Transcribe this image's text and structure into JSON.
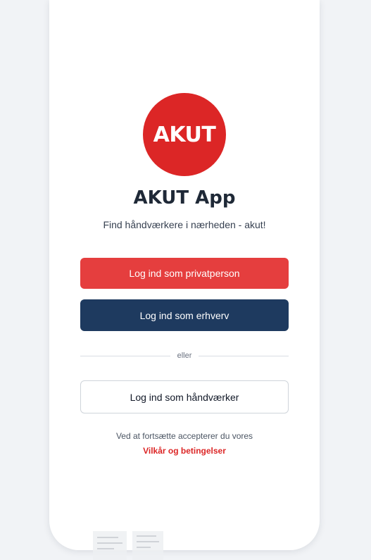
{
  "colors": {
    "brand_red": "#dc2626",
    "private_button": "#e53e3e",
    "business_button": "#1e3a5f",
    "background": "#f1f3f6"
  },
  "logo": {
    "text": "AKUT"
  },
  "header": {
    "title": "AKUT App",
    "subtitle": "Find håndværkere i nærheden - akut!"
  },
  "buttons": {
    "private_label": "Log ind som privatperson",
    "business_label": "Log ind som erhverv",
    "craftsman_label": "Log ind som håndværker"
  },
  "divider": {
    "label": "eller"
  },
  "terms": {
    "text": "Ved at fortsætte accepterer du vores",
    "link_label": "Vilkår og betingelser"
  }
}
